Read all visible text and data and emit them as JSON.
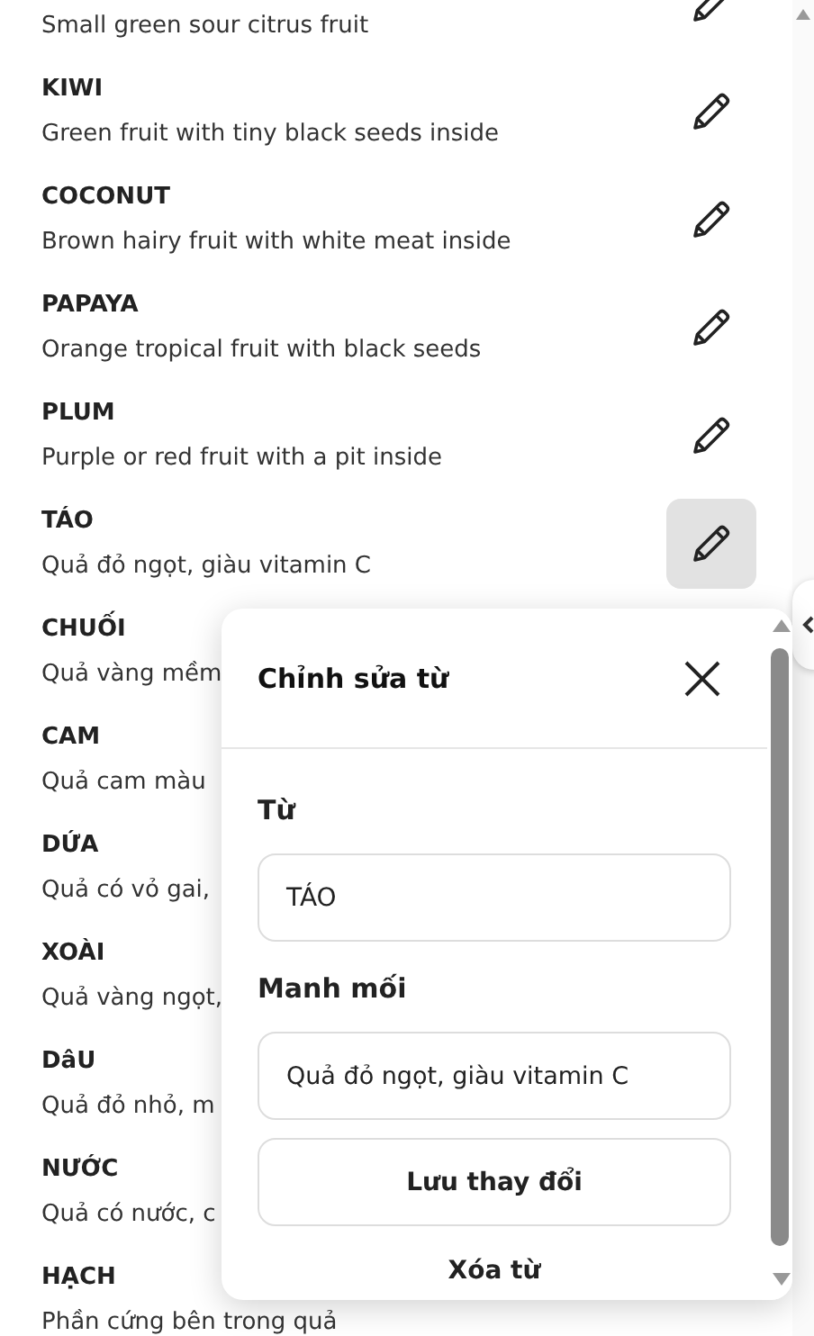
{
  "words": [
    {
      "clue": "Small green sour citrus fruit",
      "selected": false
    },
    {
      "word": "KIWI",
      "clue": "Green fruit with tiny black seeds inside",
      "selected": false
    },
    {
      "word": "COCONUT",
      "clue": "Brown hairy fruit with white meat inside",
      "selected": false
    },
    {
      "word": "PAPAYA",
      "clue": "Orange tropical fruit with black seeds",
      "selected": false
    },
    {
      "word": "PLUM",
      "clue": "Purple or red fruit with a pit inside",
      "selected": false
    },
    {
      "word": "TÁO",
      "clue": "Quả đỏ ngọt, giàu vitamin C",
      "selected": true
    },
    {
      "word": "CHUỐI",
      "clue": "Quả vàng mềm"
    },
    {
      "word": "CAM",
      "clue": "Quả cam màu"
    },
    {
      "word": "DỨA",
      "clue": "Quả có vỏ gai,"
    },
    {
      "word": "XOÀI",
      "clue": "Quả vàng ngọt,"
    },
    {
      "word": "DâU",
      "clue": "Quả đỏ nhỏ, m"
    },
    {
      "word": "NƯỚC",
      "clue": "Quả có nước, c"
    },
    {
      "word": "HẠCH",
      "clue": "Phần cứng bên trong quả"
    }
  ],
  "dialog": {
    "title": "Chỉnh sửa từ",
    "word_label": "Từ",
    "word_value": "TÁO",
    "clue_label": "Manh mối",
    "clue_value": "Quả đỏ ngọt, giàu vitamin C",
    "save_button": "Lưu thay đổi",
    "delete_button": "Xóa từ"
  }
}
